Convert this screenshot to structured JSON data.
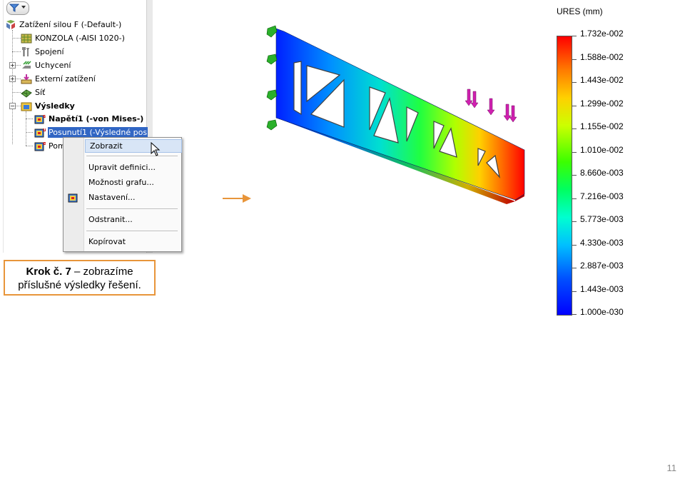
{
  "tree": {
    "items": [
      {
        "label": "Zatížení silou F (-Default-)"
      },
      {
        "label": "KONZOLA (-AISI 1020-)"
      },
      {
        "label": "Spojení"
      },
      {
        "label": "Uchycení"
      },
      {
        "label": "Externí zatížení"
      },
      {
        "label": "Síť"
      },
      {
        "label": "Výsledky"
      },
      {
        "label": "Napětí1 (-von Mises-)"
      },
      {
        "label": "Posunutí1 (-Výsledné pos"
      },
      {
        "label": "Pom"
      }
    ]
  },
  "context_menu": {
    "items": [
      {
        "label": "Zobrazit"
      },
      {
        "label": "Upravit definici..."
      },
      {
        "label": "Možnosti grafu..."
      },
      {
        "label": "Nastavení..."
      },
      {
        "label": "Odstranit..."
      },
      {
        "label": "Kopírovat"
      }
    ]
  },
  "caption": {
    "step": "Krok č. 7",
    "text": " – zobrazíme",
    "line2": "příslušné výsledky řešení."
  },
  "legend": {
    "title": "URES (mm)",
    "values": [
      "1.732e-002",
      "1.588e-002",
      "1.443e-002",
      "1.299e-002",
      "1.155e-002",
      "1.010e-002",
      "8.660e-003",
      "7.216e-003",
      "5.773e-003",
      "4.330e-003",
      "2.887e-003",
      "1.443e-003",
      "1.000e-030"
    ]
  },
  "page_number": "11",
  "colors": {
    "accent": "#e8953a",
    "selection": "#3166c4"
  }
}
